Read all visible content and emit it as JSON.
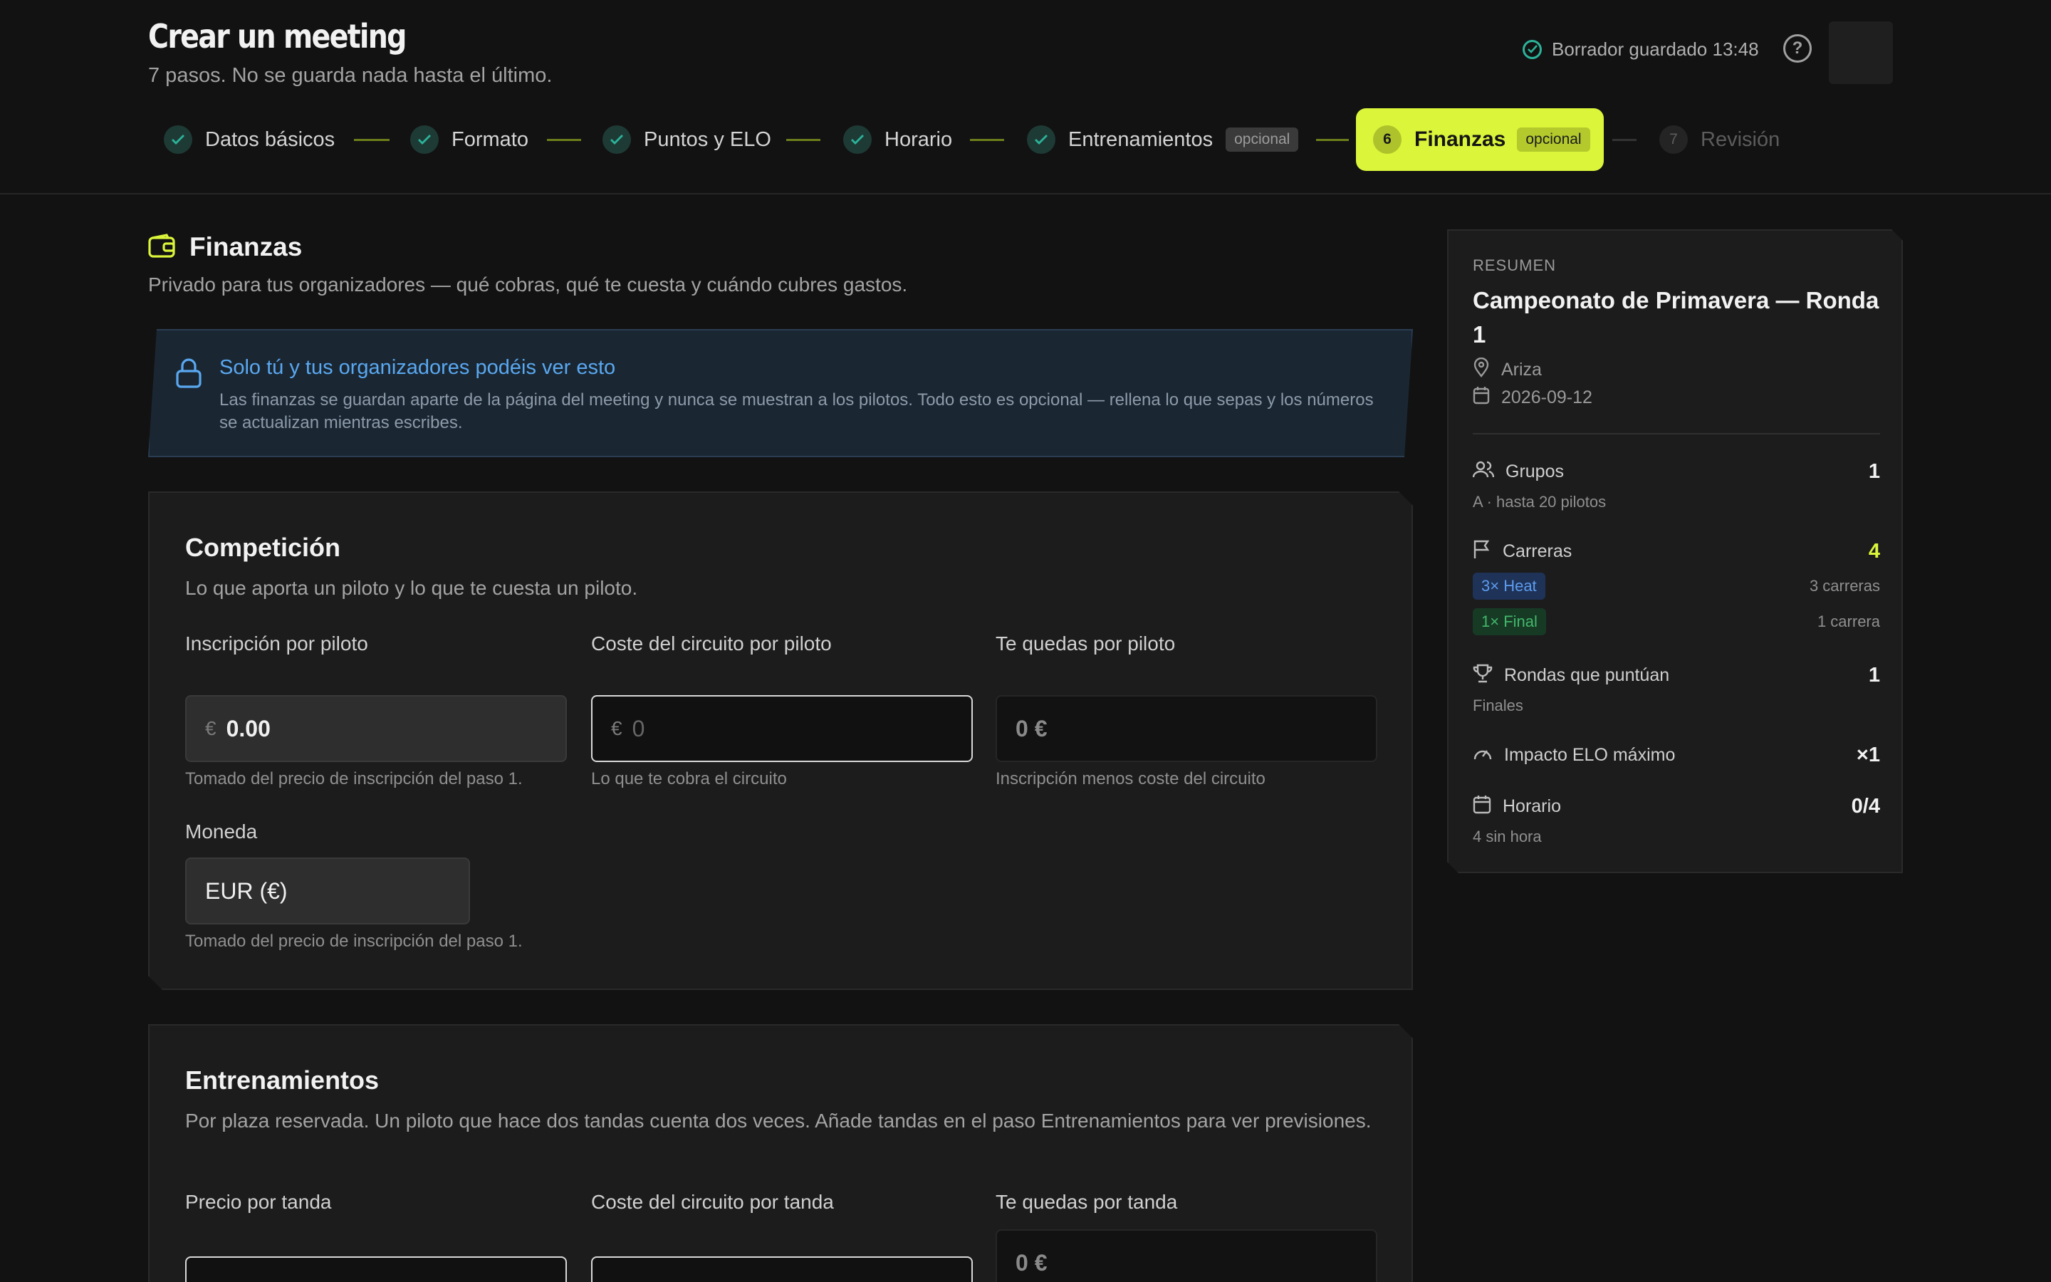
{
  "header": {
    "title": "Crear un meeting",
    "subtitle": "7 pasos. No se guarda nada hasta el último.",
    "draft_status": "Borrador guardado 13:48",
    "help_glyph": "?"
  },
  "stepper": {
    "steps": [
      {
        "label": "Datos básicos",
        "state": "done"
      },
      {
        "label": "Formato",
        "state": "done"
      },
      {
        "label": "Puntos y ELO",
        "state": "done"
      },
      {
        "label": "Horario",
        "state": "done"
      },
      {
        "label": "Entrenamientos",
        "state": "done",
        "badge": "opcional"
      },
      {
        "number": "6",
        "label": "Finanzas",
        "state": "active",
        "badge": "opcional"
      },
      {
        "number": "7",
        "label": "Revisión",
        "state": "upcoming"
      }
    ]
  },
  "section": {
    "title": "Finanzas",
    "subtitle": "Privado para tus organizadores — qué cobras, qué te cuesta y cuándo cubres gastos."
  },
  "notice": {
    "title": "Solo tú y tus organizadores podéis ver esto",
    "body": "Las finanzas se guardan aparte de la página del meeting y nunca se muestran a los pilotos. Todo esto es opcional — rellena lo que sepas y los números se actualizan mientras escribes."
  },
  "competition": {
    "title": "Competición",
    "subtitle": "Lo que aporta un piloto y lo que te cuesta un piloto.",
    "entry_fee": {
      "label": "Inscripción por piloto",
      "currency_symbol": "€",
      "value": "0.00",
      "hint": "Tomado del precio de inscripción del paso 1."
    },
    "circuit_cost": {
      "label": "Coste del circuito por piloto",
      "currency_symbol": "€",
      "placeholder": "0",
      "hint": "Lo que te cobra el circuito"
    },
    "net": {
      "label": "Te quedas por piloto",
      "value": "0 €",
      "hint": "Inscripción menos coste del circuito"
    },
    "currency": {
      "label": "Moneda",
      "value": "EUR (€)",
      "hint": "Tomado del precio de inscripción del paso 1."
    }
  },
  "training": {
    "title": "Entrenamientos",
    "subtitle": "Por plaza reservada. Un piloto que hace dos tandas cuenta dos veces. Añade tandas en el paso Entrenamientos para ver previsiones.",
    "price_label": "Precio por tanda",
    "cost_label": "Coste del circuito por tanda",
    "net_label": "Te quedas por tanda",
    "net_value": "0 €"
  },
  "summary": {
    "eyebrow": "RESUMEN",
    "name": "Campeonato de Primavera — Ronda 1",
    "location": "Ariza",
    "date": "2026-09-12",
    "groups": {
      "label": "Grupos",
      "value": "1",
      "sub": "A · hasta 20 pilotos"
    },
    "races": {
      "label": "Carreras",
      "value": "4",
      "items": [
        {
          "badge": "3× Heat",
          "count": "3 carreras",
          "color": "blue"
        },
        {
          "badge": "1× Final",
          "count": "1 carrera",
          "color": "green"
        }
      ]
    },
    "scoring": {
      "label": "Rondas que puntúan",
      "value": "1",
      "sub": "Finales"
    },
    "elo": {
      "label": "Impacto ELO máximo",
      "value": "×1"
    },
    "schedule": {
      "label": "Horario",
      "value": "0/4",
      "sub": "4 sin hora"
    }
  },
  "colors": {
    "accent": "#dbf53b",
    "check": "#2bb39a",
    "info": "#5aa8f0"
  }
}
